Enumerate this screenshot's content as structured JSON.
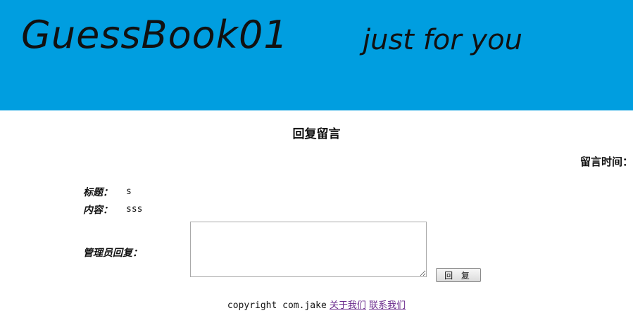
{
  "banner": {
    "title": "GuessBook01",
    "subtitle": "just for you",
    "color": "#009ee0"
  },
  "page": {
    "heading": "回复留言",
    "message_time_label": "留言时间："
  },
  "message": {
    "title_label": "标题：",
    "title_value": "s",
    "content_label": "内容：",
    "content_value": "sss"
  },
  "reply": {
    "label": "管理员回复：",
    "textarea_value": "",
    "button_label": "回 复"
  },
  "footer": {
    "copyright": "copyright com.jake",
    "link_about": "关于我们",
    "link_contact": "联系我们",
    "link_color": "#6a2a8c"
  }
}
